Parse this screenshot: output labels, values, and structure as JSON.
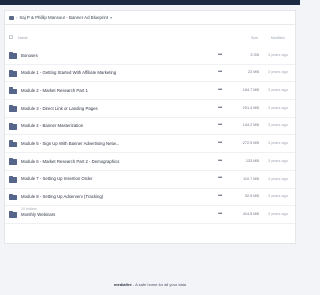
{
  "app": {
    "topbar_color": "#1c2942"
  },
  "breadcrumb": {
    "title": "Saj P & Phillip Mansour - Banner Ad Blueprint"
  },
  "columns": {
    "name": "Name",
    "size": "Size",
    "modified": "Modified"
  },
  "rows": [
    {
      "name": "Bonuses",
      "size": "3 GB",
      "modified": "3 years ago"
    },
    {
      "name": "Module 1 - Getting Started With Affiliate Marketing",
      "size": "22 MB",
      "modified": "3 years ago"
    },
    {
      "name": "Module 2 - Market Research Part 1",
      "size": "184.7 MB",
      "modified": "3 years ago"
    },
    {
      "name": "Module 3 - Direct Link or Landing Pages",
      "size": "201.4 MB",
      "modified": "3 years ago"
    },
    {
      "name": "Module 4 - Banner Masterization",
      "size": "144.2 MB",
      "modified": "3 years ago"
    },
    {
      "name": "Module 5 - Sign Up With Banner Advertising Netw...",
      "size": "272.5 MB",
      "modified": "3 years ago"
    },
    {
      "name": "Module 6 - Market Research Part 2 - Demographics",
      "size": "133 MB",
      "modified": "3 years ago"
    },
    {
      "name": "Module 7 - Setting Up Insertion Order",
      "size": "110.7 MB",
      "modified": "3 years ago"
    },
    {
      "name": "Module 8 - Setting Up Adserverv (Tracking)",
      "size": "92.9 MB",
      "modified": "3 years ago"
    },
    {
      "name": "Monthly Webinars",
      "size": "414.5 MB",
      "modified": "3 years ago"
    }
  ],
  "row_more": "•••",
  "summary": {
    "count": "10 folders"
  },
  "footer": {
    "brand": "mediafire",
    "tagline": " - A safe home for all your data"
  },
  "icons": {
    "folder": "folder-icon",
    "more": "more-icon"
  }
}
